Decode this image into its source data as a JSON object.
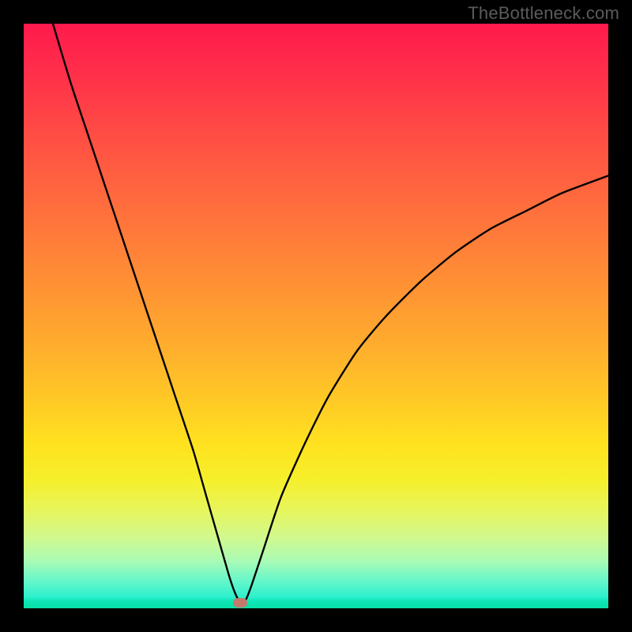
{
  "watermark": "TheBottleneck.com",
  "chart_data": {
    "type": "line",
    "title": "",
    "xlabel": "",
    "ylabel": "",
    "x_range": [
      0,
      100
    ],
    "y_range": [
      0,
      100
    ],
    "grid": false,
    "legend": false,
    "colors": {
      "curve": "#000000",
      "background_top": "#ff1a4d",
      "background_bottom": "#0ee6b5",
      "marker": "#c47a6a"
    },
    "marker": {
      "x": 37,
      "y": 1
    },
    "series": [
      {
        "name": "bottleneck-curve",
        "points": [
          {
            "x": 5,
            "y": 100
          },
          {
            "x": 8,
            "y": 90
          },
          {
            "x": 11,
            "y": 81
          },
          {
            "x": 14,
            "y": 72
          },
          {
            "x": 17,
            "y": 63
          },
          {
            "x": 20,
            "y": 54
          },
          {
            "x": 23,
            "y": 45
          },
          {
            "x": 26,
            "y": 36
          },
          {
            "x": 29,
            "y": 27
          },
          {
            "x": 31,
            "y": 20
          },
          {
            "x": 33,
            "y": 13
          },
          {
            "x": 35,
            "y": 6
          },
          {
            "x": 36,
            "y": 3
          },
          {
            "x": 37,
            "y": 1
          },
          {
            "x": 38,
            "y": 1.5
          },
          {
            "x": 39,
            "y": 4
          },
          {
            "x": 41,
            "y": 10
          },
          {
            "x": 44,
            "y": 19
          },
          {
            "x": 48,
            "y": 28
          },
          {
            "x": 52,
            "y": 36
          },
          {
            "x": 57,
            "y": 44
          },
          {
            "x": 62,
            "y": 50
          },
          {
            "x": 68,
            "y": 56
          },
          {
            "x": 74,
            "y": 61
          },
          {
            "x": 80,
            "y": 65
          },
          {
            "x": 86,
            "y": 68
          },
          {
            "x": 92,
            "y": 71
          },
          {
            "x": 100,
            "y": 74
          }
        ]
      }
    ]
  }
}
